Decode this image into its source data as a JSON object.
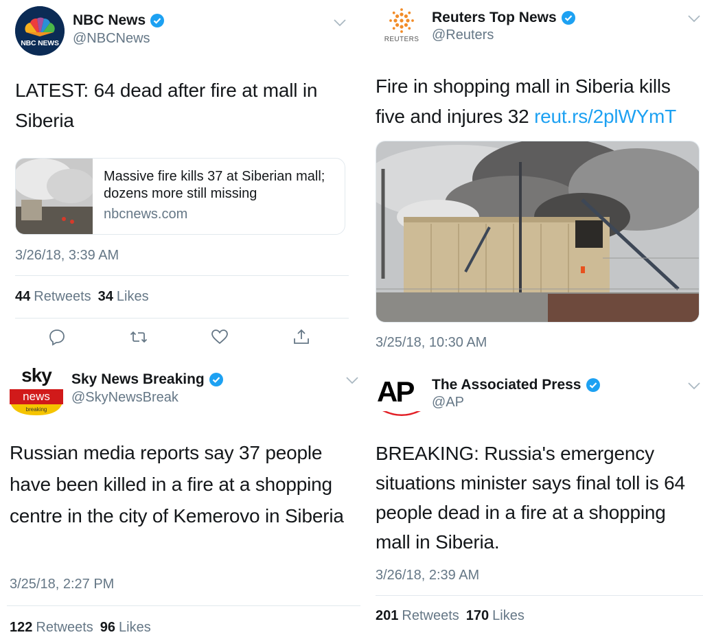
{
  "colors": {
    "verified": "#1da1f2",
    "link": "#1da1f2",
    "secondary": "#657786"
  },
  "tweets": [
    {
      "name": "NBC News",
      "handle": "@NBCNews",
      "avatar_text": "NBC NEWS",
      "text": "LATEST: 64 dead after fire at mall in Siberia",
      "card": {
        "title": "Massive fire kills 37 at Siberian mall; dozens more still missing",
        "domain": "nbcnews.com"
      },
      "timestamp": "3/26/18, 3:39 AM",
      "retweets": "44",
      "retweets_label": "Retweets",
      "likes": "34",
      "likes_label": "Likes"
    },
    {
      "name": "Reuters Top News",
      "handle": "@Reuters",
      "avatar_text": "REUTERS",
      "text": "Fire in shopping mall in Siberia kills five and injures 32",
      "link": "reut.rs/2plWYmT",
      "timestamp": "3/25/18, 10:30 AM"
    },
    {
      "name": "Sky News Breaking",
      "handle": "@SkyNewsBreak",
      "avatar_logo": "sky",
      "avatar_word": "news",
      "avatar_small": "breaking",
      "text": "Russian media reports say 37 people have been killed in a fire at a shopping centre in the city of Kemerovo in Siberia",
      "timestamp": "3/25/18, 2:27 PM",
      "retweets": "122",
      "retweets_label": "Retweets",
      "likes": "96",
      "likes_label": "Likes"
    },
    {
      "name": "The Associated Press",
      "handle": "@AP",
      "avatar_text": "AP",
      "text": "BREAKING: Russia's emergency situations minister says final toll is 64 people dead in a fire at a shopping mall in Siberia.",
      "timestamp": "3/26/18, 2:39 AM",
      "retweets": "201",
      "retweets_label": "Retweets",
      "likes": "170",
      "likes_label": "Likes"
    }
  ]
}
